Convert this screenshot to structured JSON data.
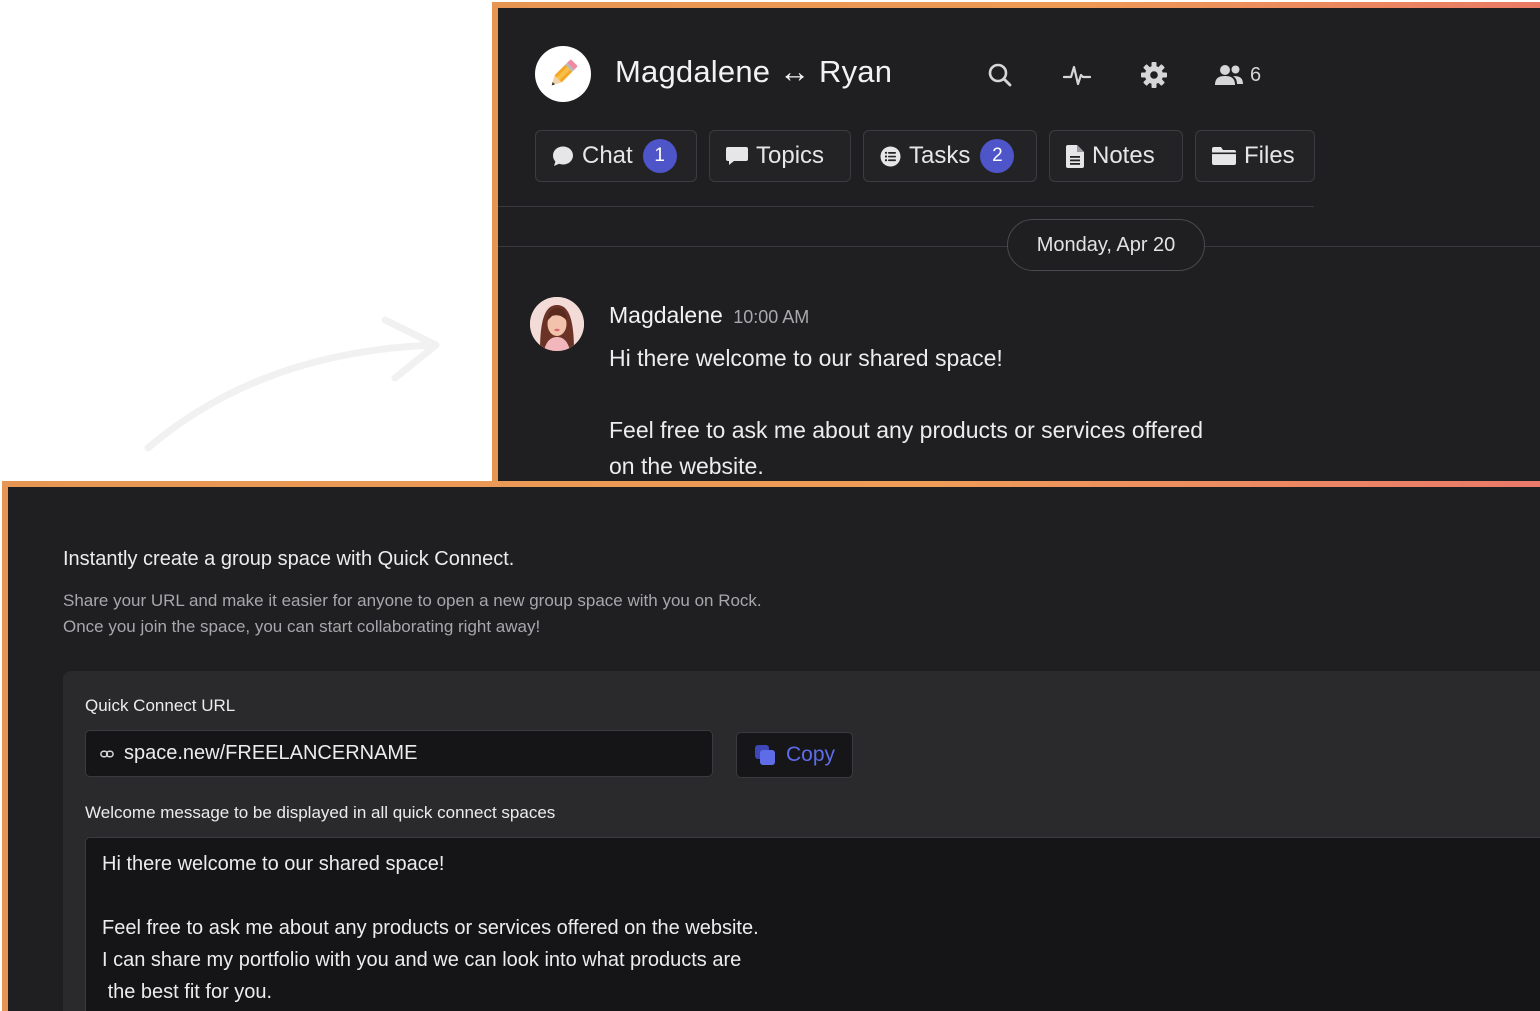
{
  "space": {
    "title": "Magdalene ↔ Ryan",
    "avatar_icon": "pencil-icon",
    "member_count": "6",
    "header_icons": [
      "search-icon",
      "activity-icon",
      "gear-icon",
      "members-icon"
    ],
    "tabs": [
      {
        "label": "Chat",
        "icon": "chat-bubble-icon",
        "badge": "1"
      },
      {
        "label": "Topics",
        "icon": "message-square-icon",
        "badge": ""
      },
      {
        "label": "Tasks",
        "icon": "list-icon",
        "badge": "2"
      },
      {
        "label": "Notes",
        "icon": "document-icon",
        "badge": ""
      },
      {
        "label": "Files",
        "icon": "folder-icon",
        "badge": ""
      }
    ],
    "date_divider": "Monday, Apr 20",
    "message": {
      "author": "Magdalene",
      "time": "10:00 AM",
      "line1": "Hi there welcome to our shared space!",
      "line2": "Feel free to ask me about any products or services offered",
      "line3": "on the website."
    }
  },
  "quick_connect": {
    "heading": "Instantly create a group space with Quick Connect.",
    "description": "Share your URL and make it easier for anyone to open a new group space with you on Rock. Once you join the space, you can start collaborating right away!",
    "url_label": "Quick Connect URL",
    "url_value": "space.new/FREELANCERNAME",
    "copy_label": "Copy",
    "welcome_label": "Welcome message to be displayed in all quick connect spaces",
    "welcome_message": "Hi there welcome to our shared space!\n\nFeel free to ask me about any products or services offered on the website.\nI can share my portfolio with you and we can look into what products are\n the best fit for you."
  },
  "colors": {
    "panel_bg": "#1f1f21",
    "border_gradient_start": "#e79553",
    "border_gradient_end": "#e9786a",
    "badge": "#4d55c9",
    "copy_accent": "#5f6ce8"
  }
}
